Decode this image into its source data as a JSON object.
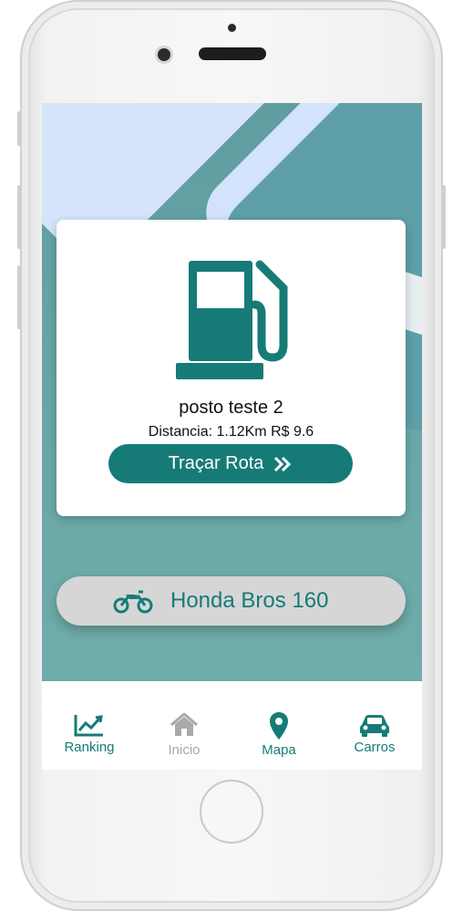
{
  "card": {
    "station_name": "posto teste 2",
    "distance": "Distancia: 1.12Km R$ 9.6",
    "route_button": "Traçar Rota"
  },
  "vehicle": {
    "name": "Honda Bros 160",
    "icon": "motorcycle-icon"
  },
  "nav": {
    "items": [
      {
        "label": "Ranking",
        "icon": "chart-line-icon",
        "color": "#167b77"
      },
      {
        "label": "Inicio",
        "icon": "home-icon",
        "color": "#a9a9a9"
      },
      {
        "label": "Mapa",
        "icon": "map-marker-icon",
        "color": "#167b77"
      },
      {
        "label": "Carros",
        "icon": "car-icon",
        "color": "#167b77"
      }
    ]
  },
  "colors": {
    "accent": "#167b77",
    "inactive": "#a9a9a9"
  }
}
